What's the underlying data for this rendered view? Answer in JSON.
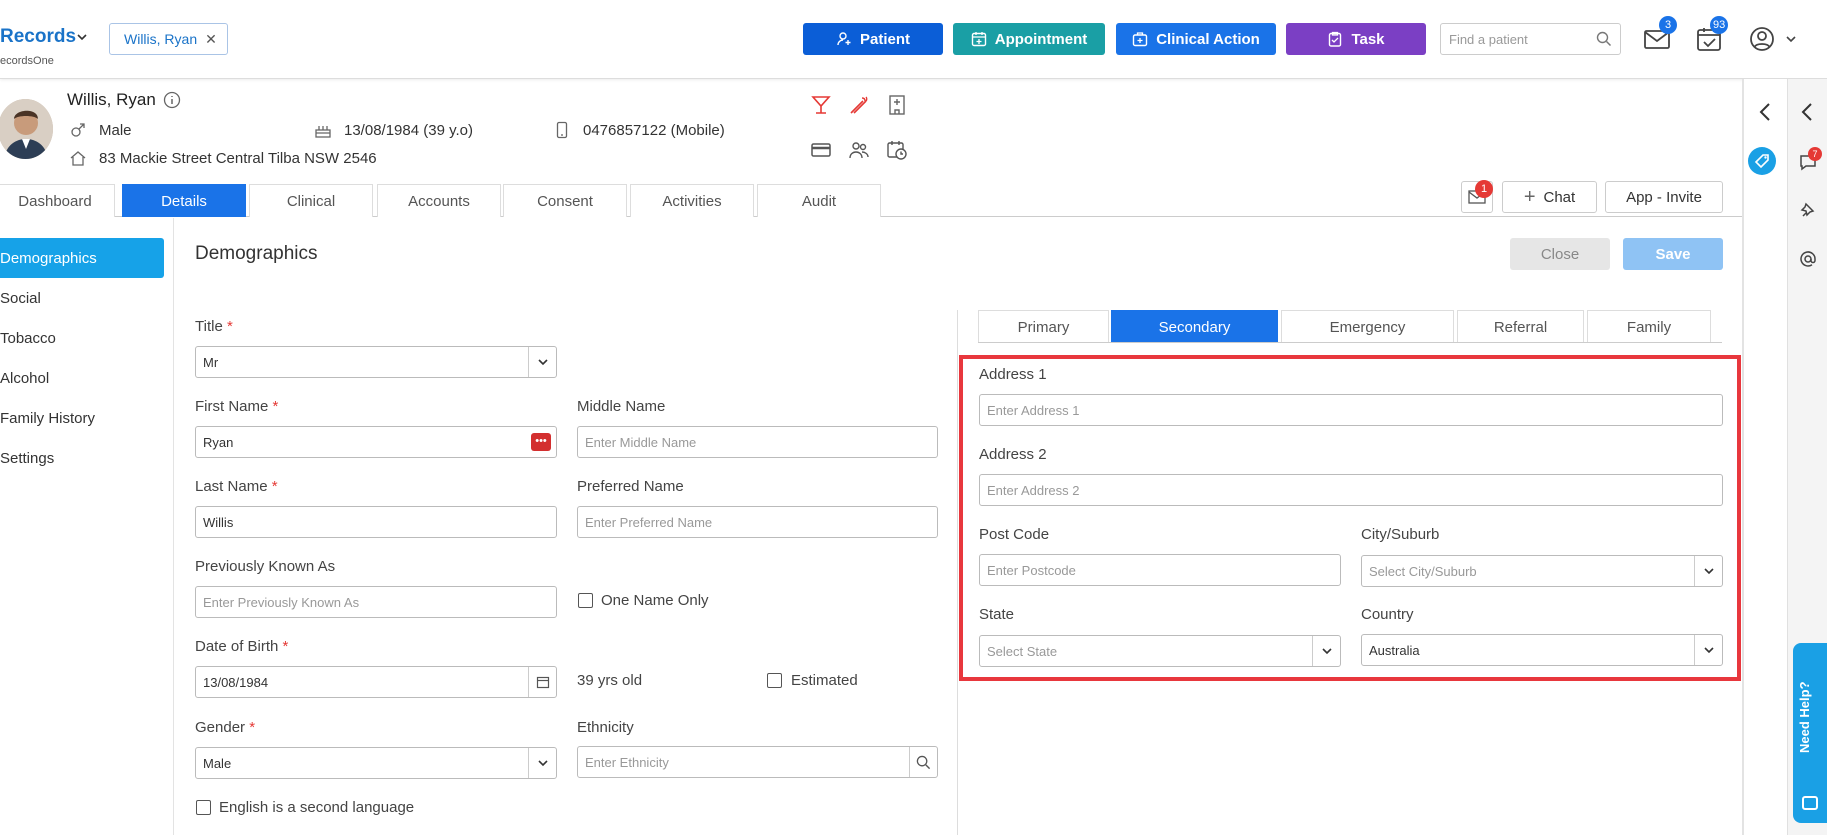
{
  "topbar": {
    "brand": "Records",
    "brand_sub": "ecordsOne",
    "patient_tab": "Willis, Ryan",
    "buttons": {
      "patient": "Patient",
      "appointment": "Appointment",
      "clinical_action": "Clinical Action",
      "task": "Task"
    },
    "colors": {
      "patient": "#0b5ed7",
      "appointment": "#1a9fa5",
      "clinical_action": "#1a73e8",
      "task": "#7b3fc4"
    },
    "search_placeholder": "Find a patient",
    "mail_badge": "3",
    "calendar_badge": "93"
  },
  "patient": {
    "name": "Willis, Ryan",
    "gender": "Male",
    "dob": "13/08/1984 (39 y.o)",
    "phone": "0476857122 (Mobile)",
    "address": "83 Mackie Street Central Tilba NSW 2546"
  },
  "tabs": [
    "Dashboard",
    "Details",
    "Clinical",
    "Accounts",
    "Consent",
    "Activities",
    "Audit"
  ],
  "utility": {
    "message_badge": "1",
    "chat": "Chat",
    "app_invite": "App - Invite"
  },
  "sidebar": [
    "Demographics",
    "Social",
    "Tobacco",
    "Alcohol",
    "Family History",
    "Settings"
  ],
  "section": {
    "title": "Demographics",
    "close": "Close",
    "save": "Save"
  },
  "form": {
    "title_label": "Title",
    "title_value": "Mr",
    "first_name_label": "First Name",
    "first_name_value": "Ryan",
    "middle_name_label": "Middle Name",
    "middle_name_placeholder": "Enter Middle Name",
    "last_name_label": "Last Name",
    "last_name_value": "Willis",
    "preferred_name_label": "Preferred Name",
    "preferred_name_placeholder": "Enter Preferred Name",
    "prev_known_label": "Previously Known As",
    "prev_known_placeholder": "Enter Previously Known As",
    "one_name_only": "One Name Only",
    "dob_label": "Date of Birth",
    "dob_value": "13/08/1984",
    "age_text": "39 yrs old",
    "estimated": "Estimated",
    "gender_label": "Gender",
    "gender_value": "Male",
    "ethnicity_label": "Ethnicity",
    "ethnicity_placeholder": "Enter Ethnicity",
    "english_second": "English is a second language"
  },
  "address_tabs": [
    "Primary",
    "Secondary",
    "Emergency",
    "Referral",
    "Family"
  ],
  "address": {
    "address1_label": "Address 1",
    "address1_placeholder": "Enter Address 1",
    "address2_label": "Address 2",
    "address2_placeholder": "Enter Address 2",
    "postcode_label": "Post Code",
    "postcode_placeholder": "Enter Postcode",
    "city_label": "City/Suburb",
    "city_placeholder": "Select City/Suburb",
    "state_label": "State",
    "state_placeholder": "Select State",
    "country_label": "Country",
    "country_value": "Australia"
  },
  "rightbar": {
    "chat_badge": "7",
    "help": "Need Help?"
  }
}
